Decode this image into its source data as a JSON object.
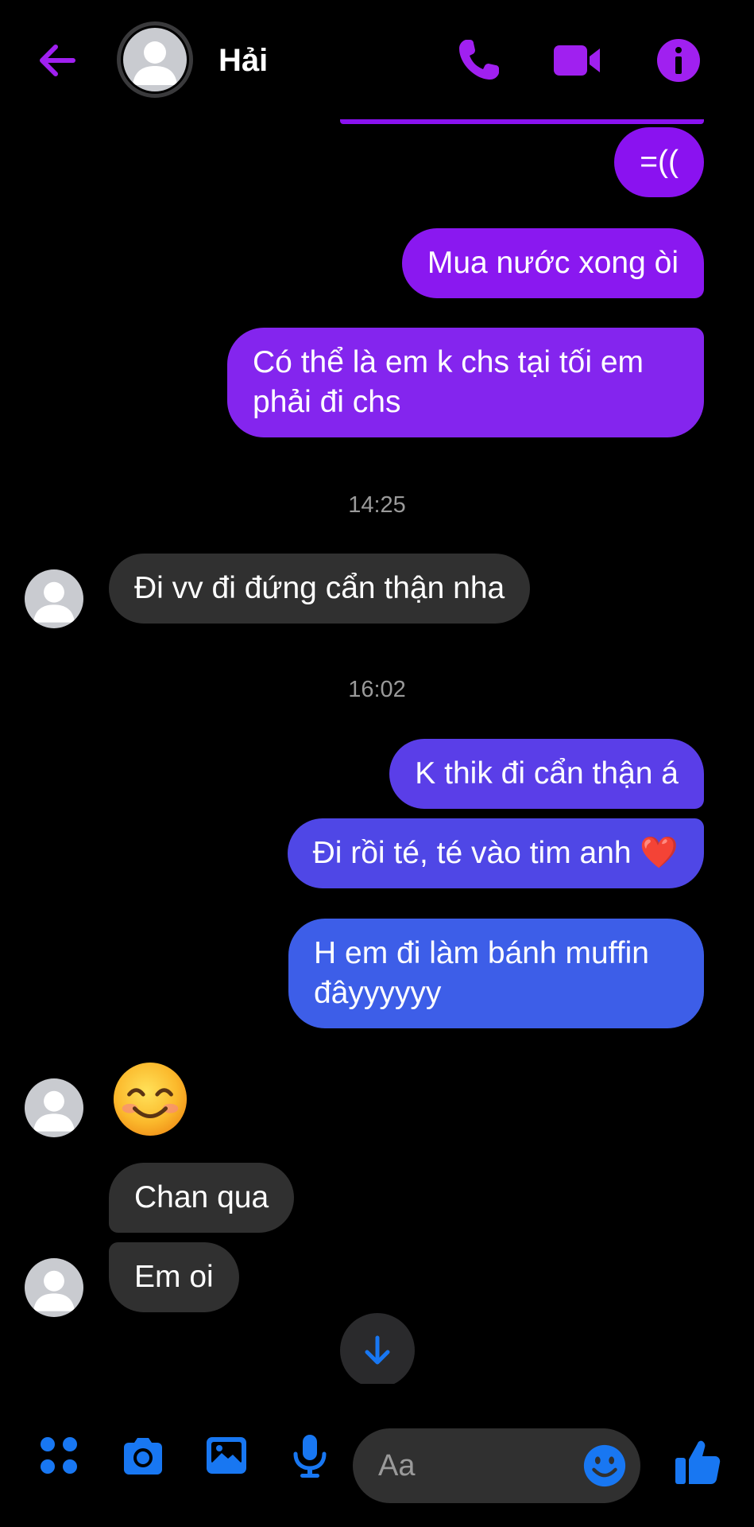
{
  "colors": {
    "accent_purple": "#a020f0",
    "accent_blue": "#1877f2",
    "sent_purple": "#8a2be2",
    "sent_indigo": "#5048e5",
    "sent_blue": "#3d5ee8",
    "received_bg": "#303030",
    "background": "#000000"
  },
  "header": {
    "contact_name": "Hải",
    "back_icon": "arrow-left-icon",
    "call_icon": "phone-icon",
    "video_icon": "video-camera-icon",
    "info_icon": "info-icon"
  },
  "messages": [
    {
      "kind": "sent",
      "text": "=(("
    },
    {
      "kind": "sent",
      "text": "Mua nước xong òi"
    },
    {
      "kind": "sent",
      "text": "Có thể là em k chs tại tối em phải đi chs"
    },
    {
      "kind": "timestamp",
      "text": "14:25"
    },
    {
      "kind": "received",
      "text": "Đi vv đi đứng cẩn thận nha"
    },
    {
      "kind": "timestamp",
      "text": "16:02"
    },
    {
      "kind": "sent",
      "text": "K thik đi cẩn thận á"
    },
    {
      "kind": "sent",
      "text": "Đi rồi té, té vào tim anh ❤️"
    },
    {
      "kind": "sent",
      "text": "H em đi làm bánh muffin đâyyyyyy"
    },
    {
      "kind": "received",
      "emoji": "smiling-face-emoji"
    },
    {
      "kind": "received",
      "text": "Chan qua"
    },
    {
      "kind": "received",
      "text": "Em oi"
    }
  ],
  "scroll_down_icon": "arrow-down-icon",
  "composer": {
    "placeholder": "Aa",
    "icons": [
      "apps-icon",
      "camera-icon",
      "image-icon",
      "microphone-icon",
      "emoji-icon",
      "thumbs-up-icon"
    ]
  }
}
